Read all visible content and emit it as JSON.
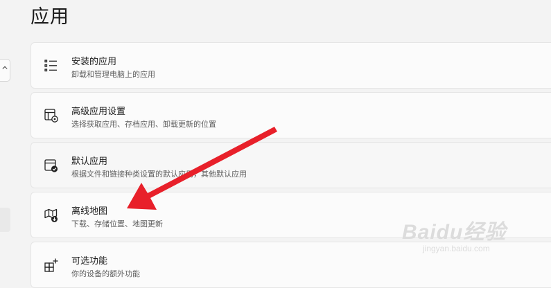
{
  "page": {
    "title": "应用"
  },
  "nav_stub": {
    "chevron": "^"
  },
  "items": [
    {
      "title": "安装的应用",
      "desc": "卸载和管理电脑上的应用",
      "icon": "list-icon"
    },
    {
      "title": "高级应用设置",
      "desc": "选择获取应用、存档应用、卸载更新的位置",
      "icon": "app-settings-icon"
    },
    {
      "title": "默认应用",
      "desc": "根据文件和链接种类设置的默认应用，其他默认应用",
      "icon": "default-apps-icon"
    },
    {
      "title": "离线地图",
      "desc": "下载、存储位置、地图更新",
      "icon": "map-download-icon"
    },
    {
      "title": "可选功能",
      "desc": "你的设备的额外功能",
      "icon": "optional-features-icon"
    }
  ],
  "annotation": {
    "arrow_color": "#e8202a"
  },
  "watermark": {
    "main": "Baidu经验",
    "sub": "jingyan.baidu.com"
  }
}
